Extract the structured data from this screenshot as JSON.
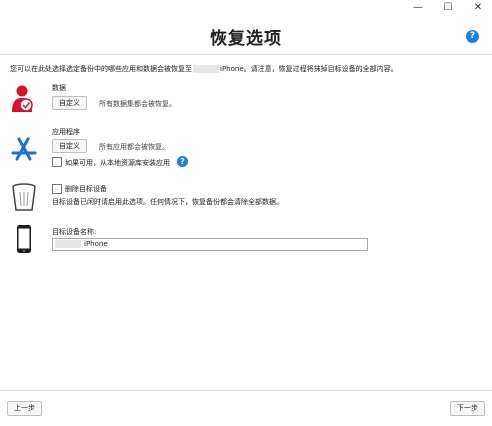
{
  "window": {
    "minimize": "—",
    "maximize": "☐",
    "close": "✕"
  },
  "title": "恢复选项",
  "notice": {
    "before": "您可以在此处选择选定备份中的哪些应用和数据会被恢复至",
    "after": "iPhone。请注意，恢复过程将抹掉目标设备的全部内容。"
  },
  "data_section": {
    "heading": "数据",
    "button": "自定义",
    "status": "所有数据集都会被恢复。"
  },
  "apps_section": {
    "heading": "应用程序",
    "button": "自定义",
    "status": "所有应用都会被恢复。",
    "checkbox_label": "如果可用，从本地资源库安装应用"
  },
  "erase_section": {
    "checkbox_label": "删除目标设备",
    "description": "目标设备已闲时请启用此选项。任何情况下，恢复备份都会清除全部数据。"
  },
  "device_section": {
    "label": "目标设备名称:",
    "name_suffix": "iPhone"
  },
  "footer": {
    "back": "上一步",
    "next": "下一步"
  },
  "help": "?"
}
